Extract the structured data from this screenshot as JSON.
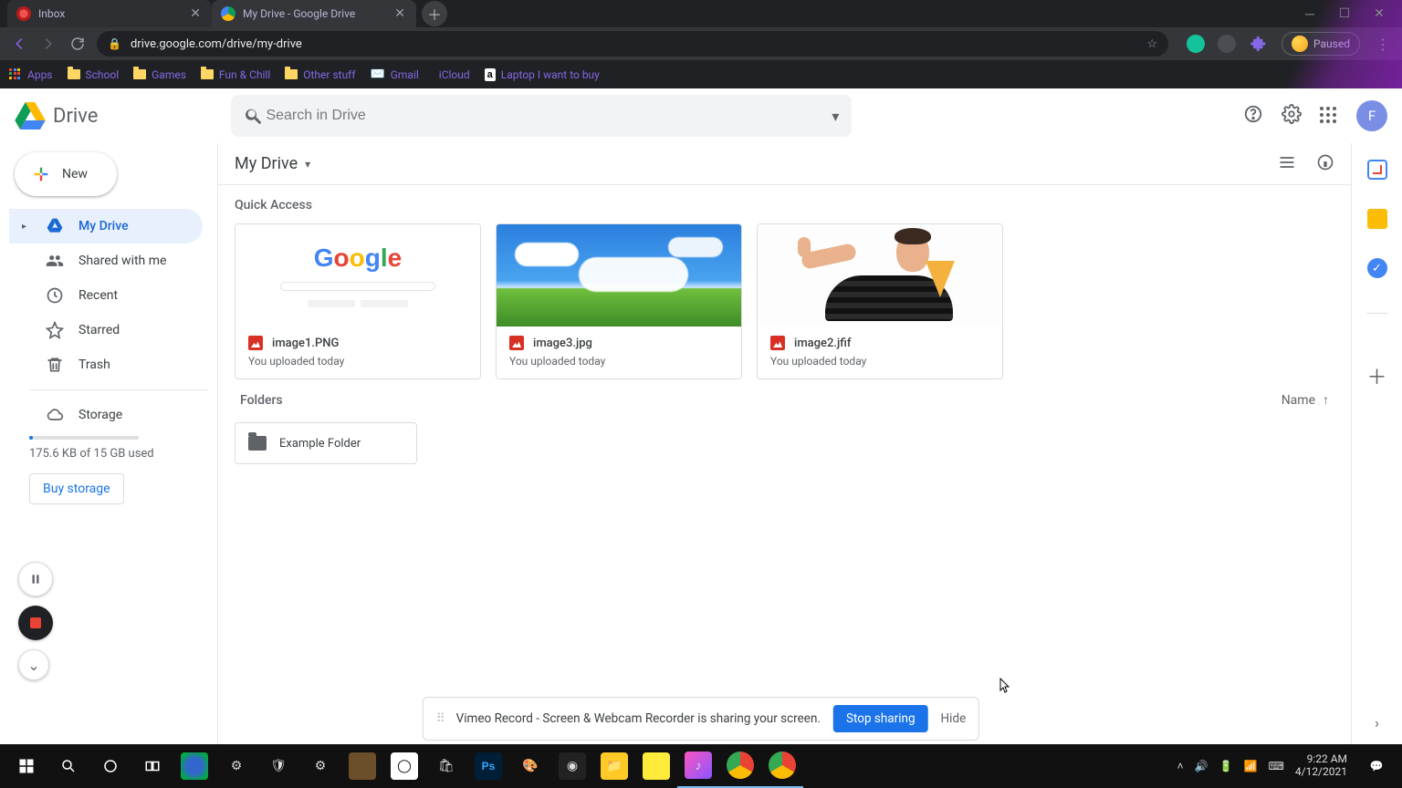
{
  "browser": {
    "tabs": [
      {
        "title": "Inbox",
        "favicon": "#b71c1c",
        "active": false
      },
      {
        "title": "My Drive - Google Drive",
        "favicon": "#0f9d58",
        "active": true
      }
    ],
    "url": "drive.google.com/drive/my-drive",
    "profile_label": "Paused",
    "bookmarks": [
      {
        "label": "Apps",
        "kind": "apps"
      },
      {
        "label": "School",
        "kind": "folder"
      },
      {
        "label": "Games",
        "kind": "folder"
      },
      {
        "label": "Fun & Chill",
        "kind": "folder"
      },
      {
        "label": "Other stuff",
        "kind": "folder"
      },
      {
        "label": "Gmail",
        "kind": "gmail"
      },
      {
        "label": "iCloud",
        "kind": "apple"
      },
      {
        "label": "Laptop I want to buy",
        "kind": "amazon"
      }
    ]
  },
  "drive": {
    "product_name": "Drive",
    "search_placeholder": "Search in Drive",
    "account_initial": "F",
    "new_button": "New",
    "sidebar": {
      "items": [
        {
          "label": "My Drive",
          "active": true
        },
        {
          "label": "Shared with me"
        },
        {
          "label": "Recent"
        },
        {
          "label": "Starred"
        },
        {
          "label": "Trash"
        }
      ],
      "storage": {
        "label": "Storage",
        "usage_text": "175.6 KB of 15 GB used",
        "buy_label": "Buy storage"
      }
    },
    "path": {
      "title": "My Drive"
    },
    "quick_access": {
      "heading": "Quick Access",
      "cards": [
        {
          "name": "image1.PNG",
          "subtitle": "You uploaded today"
        },
        {
          "name": "image3.jpg",
          "subtitle": "You uploaded today"
        },
        {
          "name": "image2.jfif",
          "subtitle": "You uploaded today"
        }
      ]
    },
    "folders": {
      "heading": "Folders",
      "sort_label": "Name",
      "items": [
        {
          "name": "Example Folder"
        }
      ]
    }
  },
  "sharebar": {
    "text": "Vimeo Record - Screen & Webcam Recorder is sharing your screen.",
    "stop": "Stop sharing",
    "hide": "Hide"
  },
  "taskbar": {
    "time": "9:22 AM",
    "date": "4/12/2021"
  }
}
